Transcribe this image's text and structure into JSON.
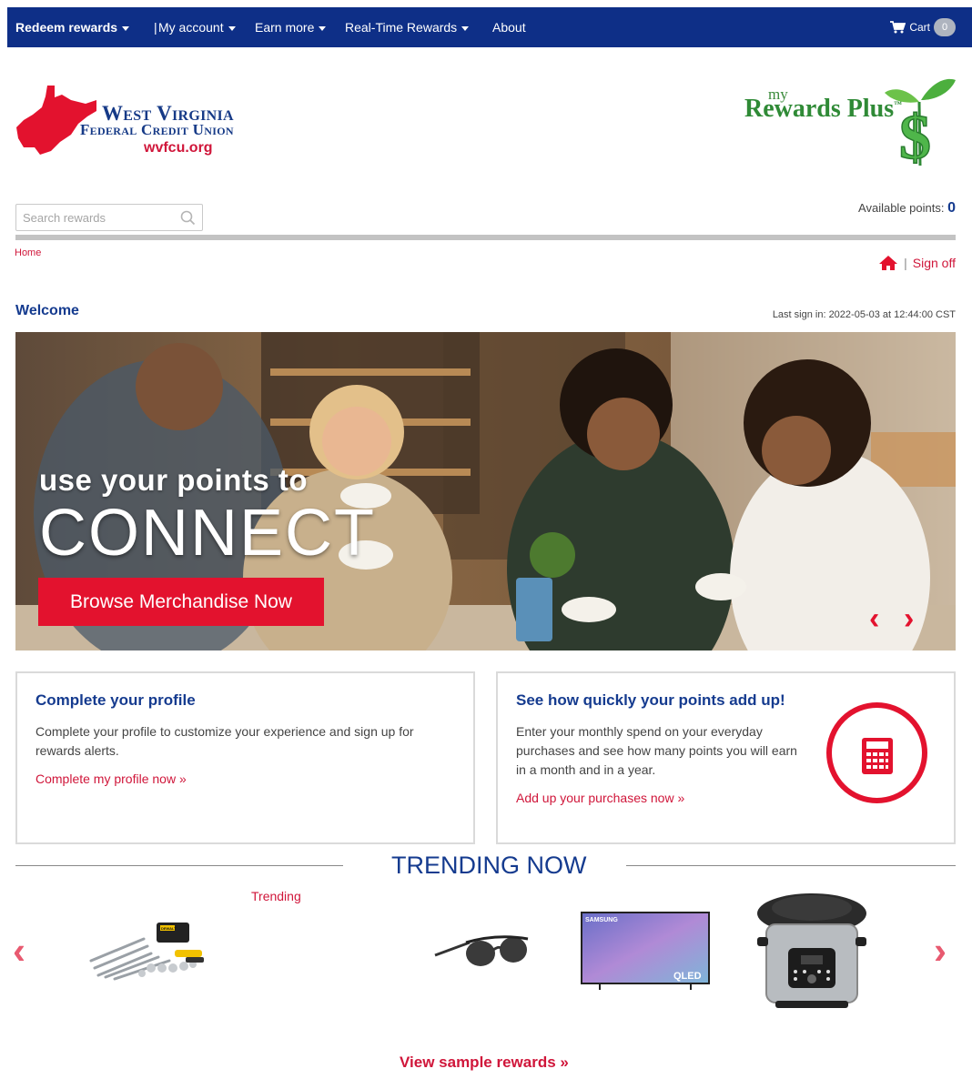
{
  "nav": {
    "items": [
      {
        "label": "Redeem rewards"
      },
      {
        "label": "My account"
      },
      {
        "label": "Earn more"
      },
      {
        "label": "Real-Time Rewards"
      },
      {
        "label": "About"
      }
    ],
    "separator": "|",
    "cart_label": "Cart",
    "cart_count": "0"
  },
  "header": {
    "bank_name_line1": "West Virginia",
    "bank_name_line2": "Federal Credit Union",
    "bank_site": "wvfcu.org",
    "program_my": "my",
    "program_name": "Rewards Plus",
    "program_tm": "™"
  },
  "search": {
    "placeholder": "Search rewards"
  },
  "points": {
    "label": "Available points:",
    "value": "0"
  },
  "breadcrumb": {
    "home": "Home"
  },
  "account_links": {
    "separator": "|",
    "sign_off": "Sign off"
  },
  "welcome": {
    "title": "Welcome",
    "last_sign_in": "Last sign in: 2022-05-03 at 12:44:00 CST"
  },
  "hero": {
    "line1": "use your points to",
    "line2": "CONNECT",
    "cta": "Browse Merchandise Now",
    "prev_arrow": "‹",
    "next_arrow": "›"
  },
  "cards": {
    "profile": {
      "title": "Complete your profile",
      "text": "Complete your profile to customize your experience and sign up for rewards alerts.",
      "link": "Complete my profile now »"
    },
    "points_calc": {
      "title": "See how quickly your points add up!",
      "text": "Enter your monthly spend on your everyday purchases and see how many points you will earn in a month and in a year.",
      "link": "Add up your purchases now »"
    }
  },
  "trending": {
    "title": "TRENDING NOW",
    "label": "Trending",
    "prev_arrow": "‹",
    "next_arrow": "›",
    "products": [
      {
        "icon": "tool-set-icon",
        "brand_text": "DEWALT"
      },
      {
        "icon": "sunglasses-icon"
      },
      {
        "icon": "television-icon",
        "brand_text": "SAMSUNG",
        "model_text": "QLED"
      },
      {
        "icon": "pressure-cooker-icon"
      }
    ],
    "sample_link": "View sample rewards »"
  },
  "colors": {
    "nav_bg": "#0e2f87",
    "brand_blue": "#153b8f",
    "accent_red": "#e3122e",
    "link_red": "#d0163a",
    "divider_gray": "#c3c3c3"
  }
}
